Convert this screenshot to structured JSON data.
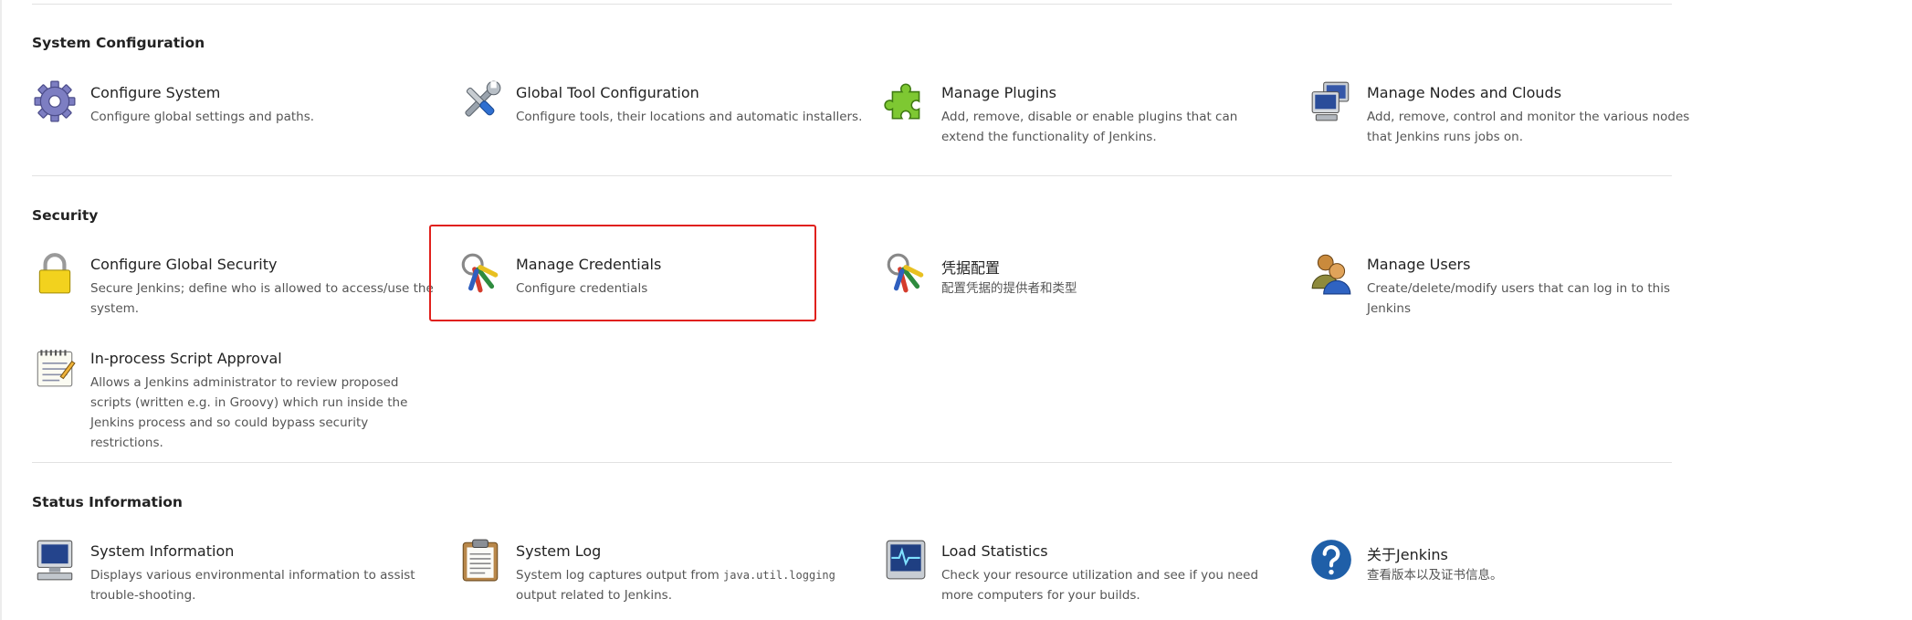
{
  "sections": {
    "system_configuration": {
      "title": "System Configuration",
      "items": [
        {
          "title": "Configure System",
          "desc": "Configure global settings and paths.",
          "icon": "gear-icon"
        },
        {
          "title": "Global Tool Configuration",
          "desc": "Configure tools, their locations and automatic installers.",
          "icon": "tools-icon"
        },
        {
          "title": "Manage Plugins",
          "desc": "Add, remove, disable or enable plugins that can extend the functionality of Jenkins.",
          "icon": "puzzle-icon"
        },
        {
          "title": "Manage Nodes and Clouds",
          "desc": "Add, remove, control and monitor the various nodes that Jenkins runs jobs on.",
          "icon": "computer-icon"
        }
      ]
    },
    "security": {
      "title": "Security",
      "items": [
        {
          "title": "Configure Global Security",
          "desc": "Secure Jenkins; define who is allowed to access/use the system.",
          "icon": "lock-icon"
        },
        {
          "title": "Manage Credentials",
          "desc": "Configure credentials",
          "icon": "keys-icon"
        },
        {
          "title": "凭据配置",
          "desc": "配置凭据的提供者和类型",
          "icon": "keys-icon"
        },
        {
          "title": "Manage Users",
          "desc": "Create/delete/modify users that can log in to this Jenkins",
          "icon": "users-icon"
        },
        {
          "title": "In-process Script Approval",
          "desc": "Allows a Jenkins administrator to review proposed scripts (written e.g. in Groovy) which run inside the Jenkins process and so could bypass security restrictions.",
          "icon": "notepad-icon"
        }
      ]
    },
    "status_information": {
      "title": "Status Information",
      "items": [
        {
          "title": "System Information",
          "desc": "Displays various environmental information to assist trouble-shooting.",
          "icon": "monitor-icon"
        },
        {
          "title": "System Log",
          "desc_before": "System log captures output from",
          "desc_code": "java.util.logging",
          "desc_after": "output related to Jenkins.",
          "icon": "clipboard-icon"
        },
        {
          "title": "Load Statistics",
          "desc": "Check your resource utilization and see if you need more computers for your builds.",
          "icon": "load-graph-icon"
        },
        {
          "title": "关于Jenkins",
          "desc": "查看版本以及证书信息。",
          "icon": "help-icon"
        }
      ]
    }
  },
  "colors": {
    "highlight": "#e0201c",
    "divider": "#e2e2e2"
  }
}
